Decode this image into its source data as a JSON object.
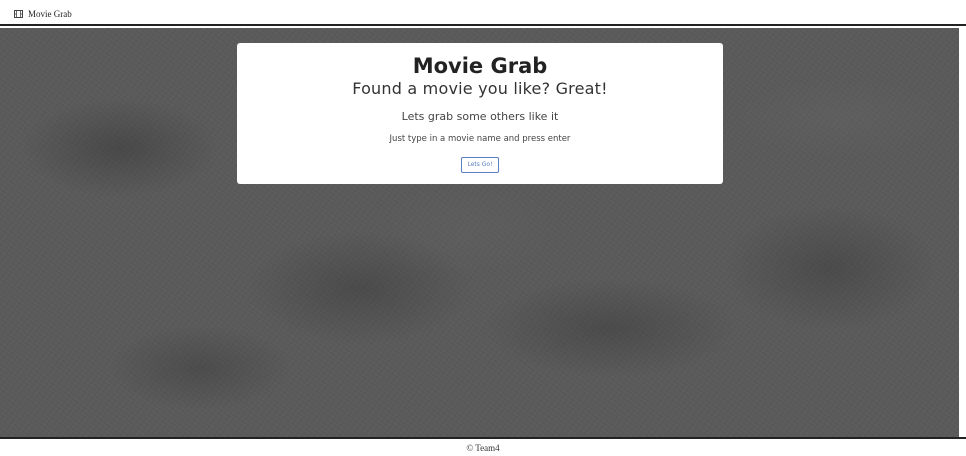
{
  "navbar": {
    "brand_icon": "film-icon",
    "brand_label": "Movie Grab"
  },
  "hero": {
    "title": "Movie Grab",
    "subtitle": "Found a movie you like? Great!",
    "lead": "Lets grab some others like it",
    "hint": "Just type in a movie name and press enter",
    "button_label": "Lets Go!",
    "button_color": "#5b7fc4"
  },
  "footer": {
    "copyright": "© Team4"
  },
  "colors": {
    "background": "#5a5a5a",
    "card": "#ffffff",
    "border": "#222222"
  }
}
